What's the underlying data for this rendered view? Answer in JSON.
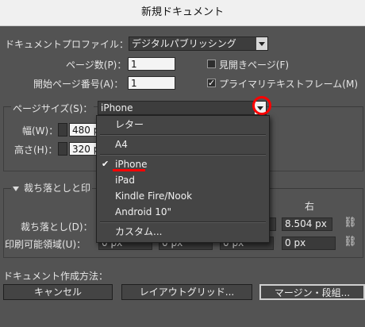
{
  "window": {
    "title": "新規ドキュメント"
  },
  "profile": {
    "label": "ドキュメントプロファイル：",
    "value": "デジタルパブリッシング"
  },
  "pages": {
    "label": "ページ数(P)：",
    "value": "1"
  },
  "facing": {
    "label": "見開きページ(F)",
    "checked": false
  },
  "start_page": {
    "label": "開始ページ番号(A)：",
    "value": "1"
  },
  "primary_frame": {
    "label": "プライマリテキストフレーム(M)",
    "checked": true
  },
  "page_size": {
    "label": "ページサイズ(S)：",
    "value": "iPhone"
  },
  "width": {
    "label": "幅(W)：",
    "value": "480 p"
  },
  "height": {
    "label": "高さ(H)：",
    "value": "320 p"
  },
  "bleed_section": {
    "title": "裁ち落としと印"
  },
  "right_col": {
    "label": "右"
  },
  "bleed": {
    "label": "裁ち落とし(D)：",
    "right": "8.504 px"
  },
  "slug": {
    "label": "印刷可能領域(U)：",
    "values": [
      "0 px",
      "0 px",
      "0 px",
      "0 px"
    ]
  },
  "create_method": {
    "label": "ドキュメント作成方法："
  },
  "buttons": {
    "cancel": "キャンセル",
    "layout_grid": "レイアウトグリッド...",
    "margins": "マージン・段組..."
  },
  "menu": {
    "items": [
      "レター",
      "A4",
      "iPhone",
      "iPad",
      "Kindle Fire/Nook",
      "Android 10\"",
      "カスタム..."
    ],
    "selected_index": 2
  },
  "colors": {
    "annotation_red": "#ff0000",
    "panel": "#535353"
  }
}
